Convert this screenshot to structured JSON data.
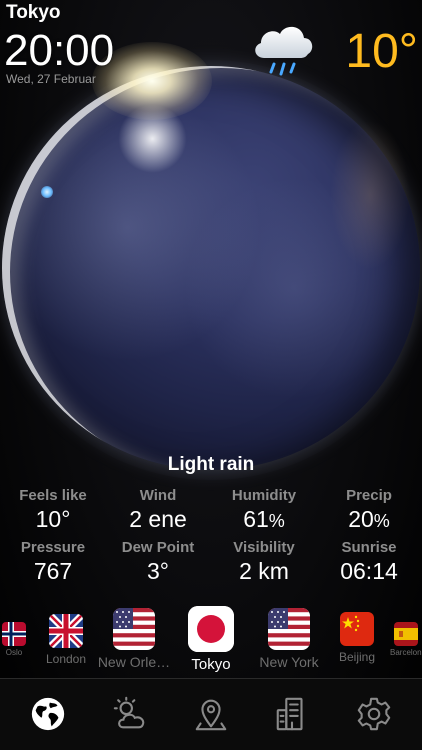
{
  "header": {
    "city": "Tokyo",
    "time": "20:00",
    "date": "Wed, 27 Februar",
    "temperature": "10°",
    "weather_icon": "cloud-rain-icon"
  },
  "condition": "Light rain",
  "stats": [
    {
      "label": "Feels like",
      "value": "10°",
      "unit": ""
    },
    {
      "label": "Wind",
      "value": "2 ene",
      "unit": ""
    },
    {
      "label": "Humidity",
      "value": "61",
      "unit": "%"
    },
    {
      "label": "Precip",
      "value": "20",
      "unit": "%"
    },
    {
      "label": "Pressure",
      "value": "767",
      "unit": ""
    },
    {
      "label": "Dew Point",
      "value": "3°",
      "unit": ""
    },
    {
      "label": "Visibility",
      "value": "2 km",
      "unit": ""
    },
    {
      "label": "Sunrise",
      "value": "06:14",
      "unit": ""
    }
  ],
  "cities": [
    {
      "name": "Oslo",
      "flag": "norway-flag"
    },
    {
      "name": "London",
      "flag": "uk-flag"
    },
    {
      "name": "New Orle…",
      "flag": "usa-flag"
    },
    {
      "name": "Tokyo",
      "flag": "japan-flag",
      "active": true
    },
    {
      "name": "New York",
      "flag": "usa-flag"
    },
    {
      "name": "Beijing",
      "flag": "china-flag"
    },
    {
      "name": "Barcelona",
      "flag": "spain-flag"
    }
  ],
  "tabs": [
    {
      "name": "globe",
      "icon": "globe-icon",
      "active": true
    },
    {
      "name": "forecast",
      "icon": "sun-cloud-icon"
    },
    {
      "name": "location",
      "icon": "location-pin-icon"
    },
    {
      "name": "cities",
      "icon": "city-list-icon"
    },
    {
      "name": "settings",
      "icon": "gear-icon"
    }
  ],
  "colors": {
    "temperature": "#ffbb1f",
    "label_gray": "#8d8d8d",
    "inactive_city": "#6e6e6e",
    "japan_red": "#d4133a"
  }
}
